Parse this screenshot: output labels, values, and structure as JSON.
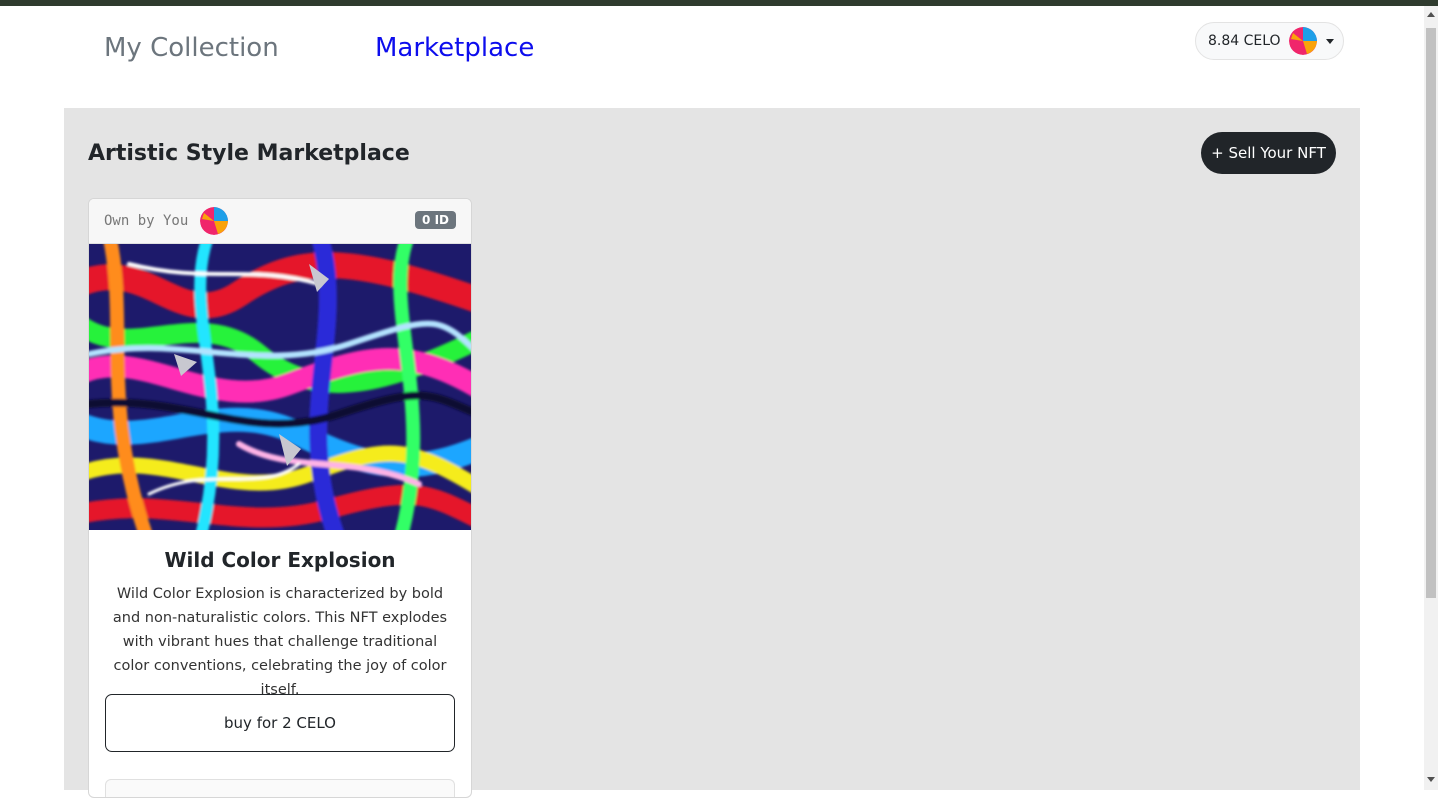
{
  "nav": {
    "my_collection": "My Collection",
    "marketplace": "Marketplace"
  },
  "wallet": {
    "balance": "8.84 CELO",
    "avatar_icon": "identicon-avatar"
  },
  "page": {
    "title": "Artistic Style Marketplace",
    "sell_button": "+ Sell Your NFT"
  },
  "card": {
    "owner_label": "Own by You",
    "id_badge": "0 ID",
    "title": "Wild Color Explosion",
    "description": "Wild Color Explosion is characterized by bold and non-naturalistic colors. This NFT explodes with vibrant hues that challenge traditional color conventions, celebrating the joy of color itself.",
    "buy_button": "buy for 2 CELO"
  },
  "colors": {
    "active_nav": "#0d0ded",
    "inactive_nav": "#6c757d",
    "dark_button": "#212529",
    "panel_bg": "#e4e4e4"
  }
}
